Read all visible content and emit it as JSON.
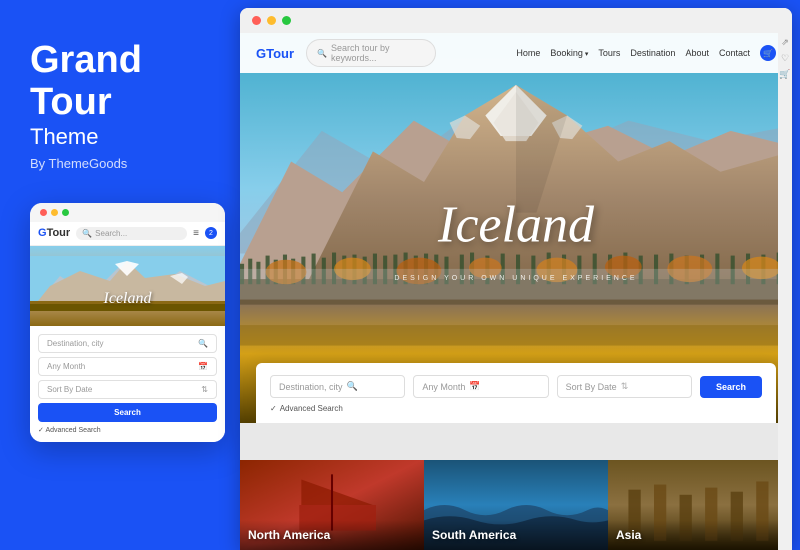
{
  "left": {
    "title_line1": "Grand",
    "title_line2": "Tour",
    "subtitle": "Theme",
    "by": "By ThemeGoods"
  },
  "mobile": {
    "logo_prefix": "G",
    "logo_text": "Tour",
    "search_placeholder": "Search...",
    "cart_count": "2",
    "hero_text": "Iceland",
    "form": {
      "destination": "Destination, city",
      "month": "Any Month",
      "sort": "Sort By Date",
      "search_btn": "Search",
      "advanced": "Advanced Search"
    }
  },
  "browser": {
    "site": {
      "logo_prefix": "G",
      "logo_text": "Tour",
      "search_placeholder": "Search tour by keywords...",
      "nav_links": [
        {
          "label": "Home",
          "has_arrow": false
        },
        {
          "label": "Booking",
          "has_arrow": true
        },
        {
          "label": "Tours",
          "has_arrow": false
        },
        {
          "label": "Destination",
          "has_arrow": false
        },
        {
          "label": "About",
          "has_arrow": false
        },
        {
          "label": "Contact",
          "has_arrow": false
        }
      ],
      "hero_text": "Iceland",
      "hero_tagline": "DESIGN YOUR OWN UNIQUE EXPERIENCE",
      "search": {
        "destination": "Destination, city",
        "month": "Any Month",
        "sort": "Sort By Date",
        "search_btn": "Search",
        "advanced": "Advanced Search"
      },
      "destinations": [
        {
          "label": "North America",
          "color_from": "#c0392b",
          "color_to": "#8B0000"
        },
        {
          "label": "South America",
          "color_from": "#2980b9",
          "color_to": "#1a5276"
        },
        {
          "label": "Asia",
          "color_from": "#7D6608",
          "color_to": "#5D4E37"
        }
      ]
    }
  }
}
